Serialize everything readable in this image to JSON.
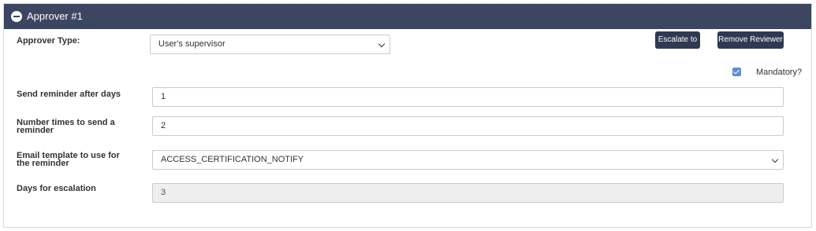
{
  "header": {
    "title": "Approver #1",
    "collapse_icon": "minus-circle-icon"
  },
  "approver_type": {
    "label": "Approver Type:",
    "selected": "User's supervisor"
  },
  "buttons": {
    "escalate_label": "Escalate to",
    "remove_label": "Remove Reviewer"
  },
  "mandatory": {
    "label": "Mandatory?",
    "checked": true
  },
  "reminder_days": {
    "label": "Send reminder after days",
    "value": "1"
  },
  "reminder_count": {
    "label": "Number times to send a reminder",
    "value": "2"
  },
  "email_template": {
    "label": "Email template to use for the reminder",
    "selected": "ACCESS_CERTIFICATION_NOTIFY"
  },
  "escalation_days": {
    "label": "Days for escalation",
    "value": "3"
  },
  "colors": {
    "header_bg": "#3d4660",
    "button_bg": "#2f3a52",
    "checkbox": "#5b8fd6"
  }
}
